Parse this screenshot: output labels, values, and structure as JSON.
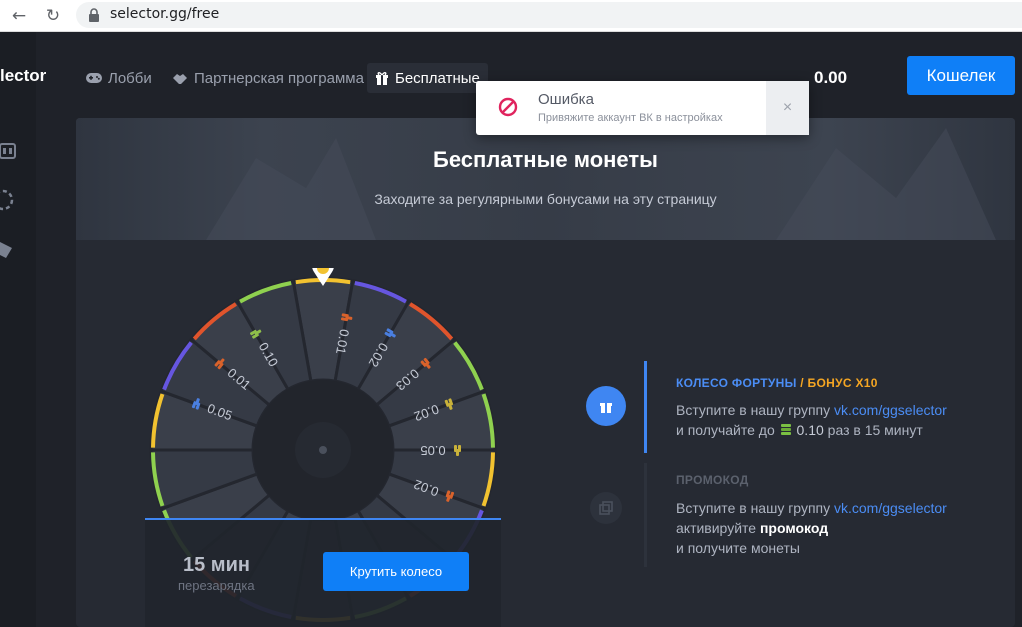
{
  "browser": {
    "url": "selector.gg/free",
    "back_icon": "arrow-left-icon",
    "refresh_icon": "refresh-icon"
  },
  "brand": {
    "text": "lector"
  },
  "nav": {
    "lobby": "Лобби",
    "partner": "Партнерская программа",
    "free": "Бесплатные",
    "balance": "0.00",
    "wallet": "Кошелек"
  },
  "toast": {
    "title": "Ошибка",
    "message": "Привяжите аккаунт ВК в настройках",
    "close": "×"
  },
  "hero": {
    "title": "Бесплатные монеты",
    "subtitle": "Заходите за регулярными бонусами на эту страницу"
  },
  "wheel": {
    "segments": [
      "0.01",
      "0.02",
      "0.03",
      "0.02",
      "0.05",
      "0.02",
      "0.05",
      "0.01",
      "0.10"
    ],
    "cooldown_value": "15 мин",
    "cooldown_label": "перезарядка",
    "spin_label": "Крутить колесо"
  },
  "bonus_wheel": {
    "title": "КОЛЕСО ФОРТУНЫ",
    "title_suffix": " / БОНУС X10",
    "line1_prefix": "Вступите в нашу группу ",
    "link": "vk.com/ggselector",
    "line2_prefix": "и получайте до ",
    "amount": "0.10",
    "line2_suffix": " раз в 15 минут"
  },
  "bonus_promo": {
    "title": "ПРОМОКОД",
    "line1_prefix": "Вступите в нашу группу ",
    "link": "vk.com/ggselector",
    "line2_prefix": "активируйте ",
    "line2_strong": "промокод",
    "line3": "и получите монеты"
  },
  "colors": {
    "accent": "#0f7ff7",
    "link": "#4b8df5",
    "title_blue": "#4b8df5",
    "title_orange": "#f5a623",
    "error": "#e0245e"
  }
}
